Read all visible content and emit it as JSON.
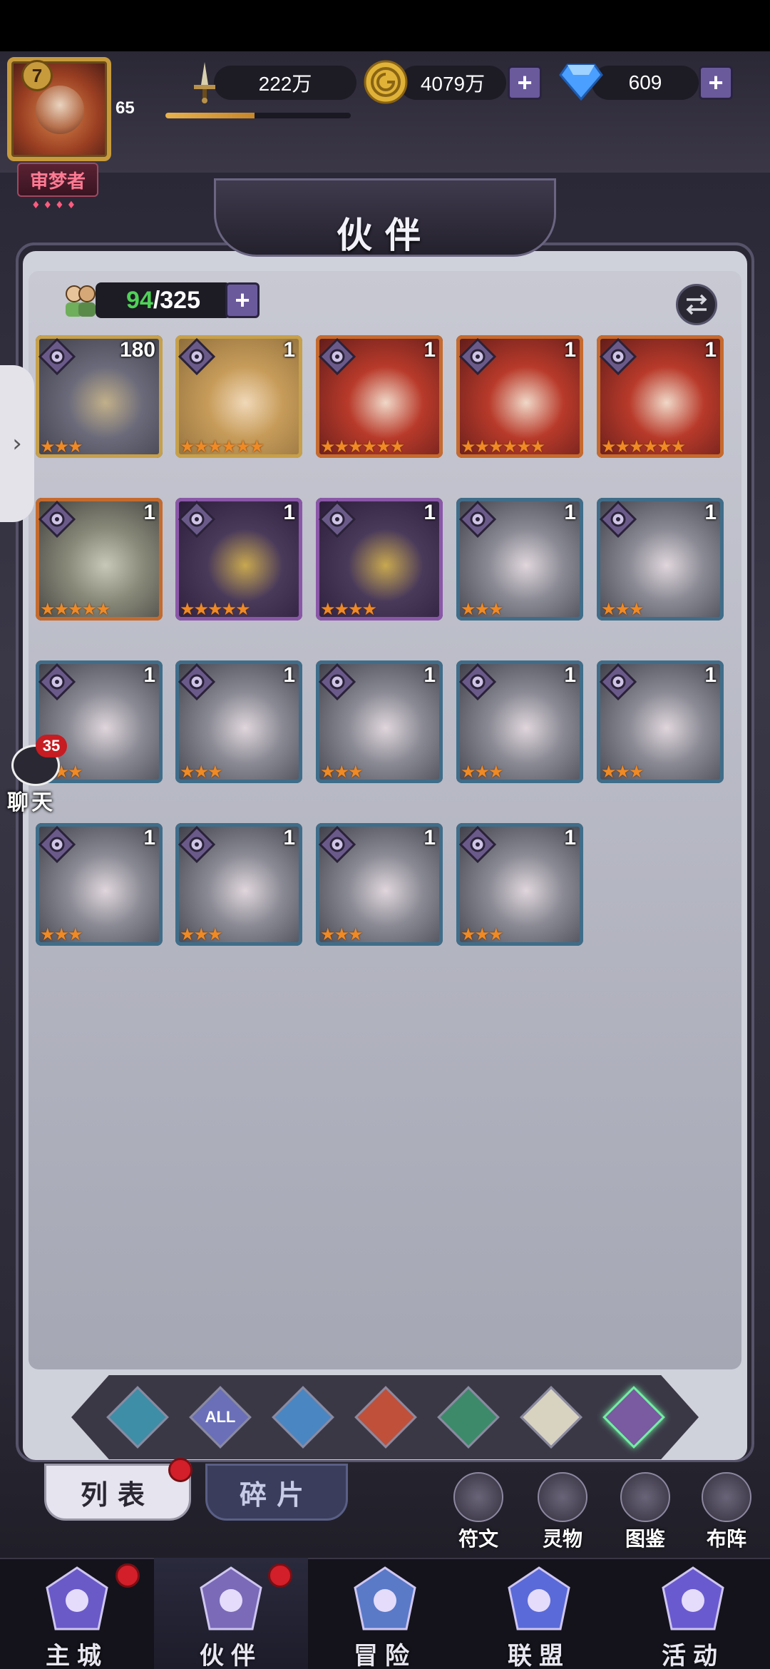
{
  "player": {
    "vip": "7",
    "level": "65",
    "title": "审梦者",
    "title_stars": "♦♦♦♦",
    "exp_fraction": 0.48
  },
  "resources": {
    "power": "222万",
    "gold": "4079万",
    "gems": "609",
    "plus": "+"
  },
  "page": {
    "title": "伙伴"
  },
  "capacity": {
    "current": "94",
    "separator": "/",
    "max": "325",
    "plus": "+"
  },
  "heroes": [
    {
      "level": "180",
      "stars": 3,
      "rarity": "gold",
      "palette": "cloak"
    },
    {
      "level": "1",
      "stars": 6,
      "rarity": "gold",
      "palette": "blonde"
    },
    {
      "level": "1",
      "stars": 6,
      "rarity": "orange",
      "palette": "redhair"
    },
    {
      "level": "1",
      "stars": 6,
      "rarity": "orange",
      "palette": "redhair"
    },
    {
      "level": "1",
      "stars": 6,
      "rarity": "orange",
      "palette": "redhair"
    },
    {
      "level": "1",
      "stars": 5,
      "rarity": "orange",
      "palette": "orc"
    },
    {
      "level": "1",
      "stars": 5,
      "rarity": "purple",
      "palette": "masked"
    },
    {
      "level": "1",
      "stars": 4,
      "rarity": "purple",
      "palette": "masked"
    },
    {
      "level": "1",
      "stars": 3,
      "rarity": "blue",
      "palette": "soldier"
    },
    {
      "level": "1",
      "stars": 3,
      "rarity": "blue",
      "palette": "soldier"
    },
    {
      "level": "1",
      "stars": 3,
      "rarity": "blue",
      "palette": "soldier"
    },
    {
      "level": "1",
      "stars": 3,
      "rarity": "blue",
      "palette": "soldier"
    },
    {
      "level": "1",
      "stars": 3,
      "rarity": "blue",
      "palette": "soldier"
    },
    {
      "level": "1",
      "stars": 3,
      "rarity": "blue",
      "palette": "soldier"
    },
    {
      "level": "1",
      "stars": 3,
      "rarity": "blue",
      "palette": "soldier"
    },
    {
      "level": "1",
      "stars": 3,
      "rarity": "blue",
      "palette": "soldier"
    },
    {
      "level": "1",
      "stars": 3,
      "rarity": "blue",
      "palette": "soldier"
    },
    {
      "level": "1",
      "stars": 3,
      "rarity": "blue",
      "palette": "soldier"
    },
    {
      "level": "1",
      "stars": 3,
      "rarity": "blue",
      "palette": "soldier"
    }
  ],
  "filters": [
    {
      "name": "faction-1",
      "label": "",
      "color": "#3d8ea6"
    },
    {
      "name": "all",
      "label": "ALL",
      "color": "#6a6fb8"
    },
    {
      "name": "water",
      "label": "",
      "color": "#4a86c2"
    },
    {
      "name": "fire",
      "label": "",
      "color": "#c0503a"
    },
    {
      "name": "wind",
      "label": "",
      "color": "#3d8a6a"
    },
    {
      "name": "light",
      "label": "",
      "color": "#d8d2c0"
    },
    {
      "name": "dark",
      "label": "",
      "color": "#7a5aa0"
    }
  ],
  "subtabs": {
    "list": "列表",
    "fragments": "碎片"
  },
  "side_buttons": [
    {
      "label": "符文",
      "icon": "rune-icon"
    },
    {
      "label": "灵物",
      "icon": "spirit-icon"
    },
    {
      "label": "图鉴",
      "icon": "codex-icon"
    },
    {
      "label": "布阵",
      "icon": "formation-icon"
    }
  ],
  "nav": [
    {
      "label": "主城",
      "icon": "castle-icon",
      "badge": true
    },
    {
      "label": "伙伴",
      "icon": "partner-icon",
      "badge": true
    },
    {
      "label": "冒险",
      "icon": "adventure-icon",
      "badge": false
    },
    {
      "label": "联盟",
      "icon": "alliance-icon",
      "badge": false
    },
    {
      "label": "活动",
      "icon": "event-icon",
      "badge": false
    }
  ],
  "chat": {
    "count": "35",
    "label": "聊天"
  },
  "colors": {
    "accent_green": "#4fd157",
    "star_orange": "#f08a24",
    "badge_red": "#d21f2a",
    "plus_purple": "#6a5a9c"
  }
}
